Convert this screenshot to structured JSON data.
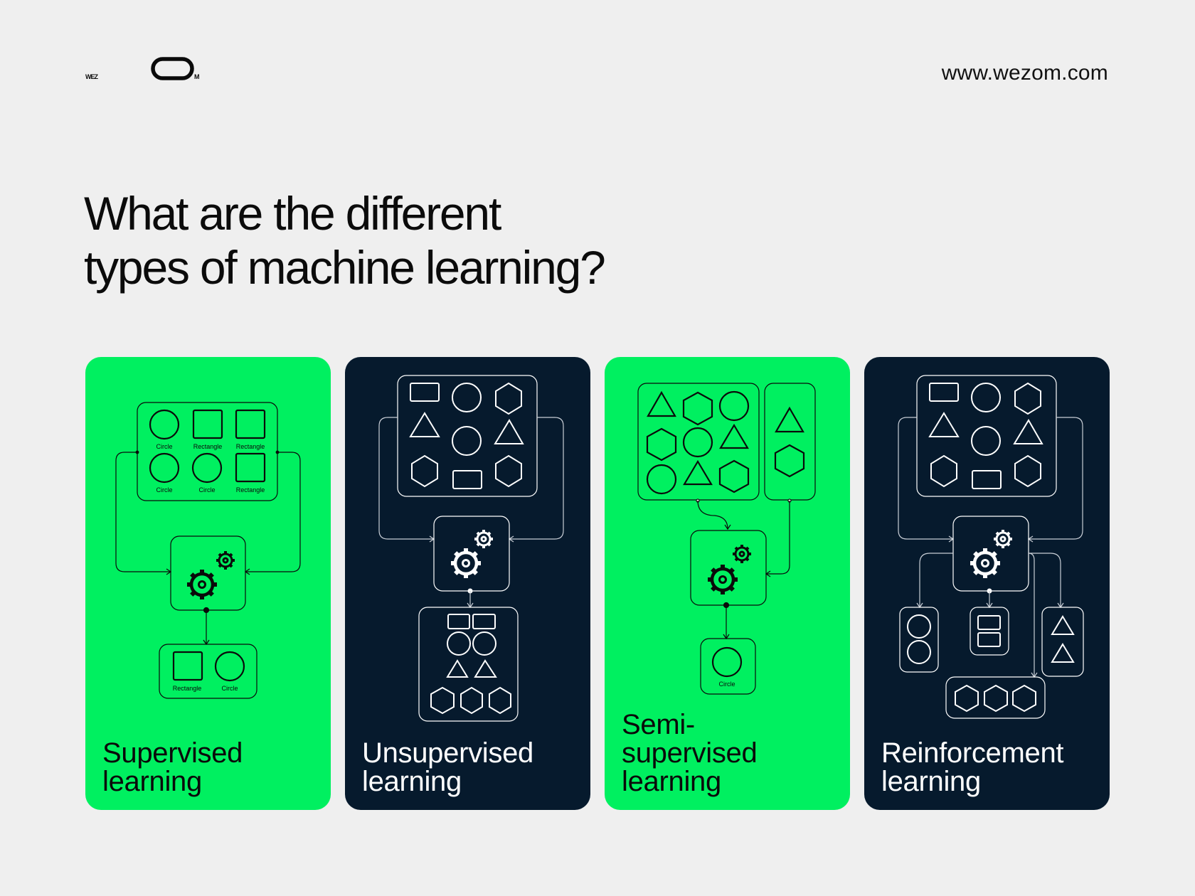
{
  "header": {
    "logo_text": "WEZOM",
    "website": "www.wezom.com"
  },
  "page_title": {
    "line1": "What are the different",
    "line2": "types of machine learning?"
  },
  "colors": {
    "accent_green": "#00f060",
    "dark_navy": "#061a2d",
    "background": "#efefef"
  },
  "cards": [
    {
      "title_line1": "Supervised",
      "title_line2": "learning",
      "theme": "green",
      "input_labels": [
        "Circle",
        "Rectangle",
        "Rectangle",
        "Circle",
        "Circle",
        "Rectangle"
      ],
      "output_labels": [
        "Rectangle",
        "Circle"
      ]
    },
    {
      "title_line1": "Unsupervised",
      "title_line2": "learning",
      "theme": "dark"
    },
    {
      "title_line1": "Semi-",
      "title_line2": "supervised",
      "title_line3": "learning",
      "theme": "green",
      "output_labels": [
        "Circle"
      ]
    },
    {
      "title_line1": "Reinforcement",
      "title_line2": "learning",
      "theme": "dark"
    }
  ]
}
